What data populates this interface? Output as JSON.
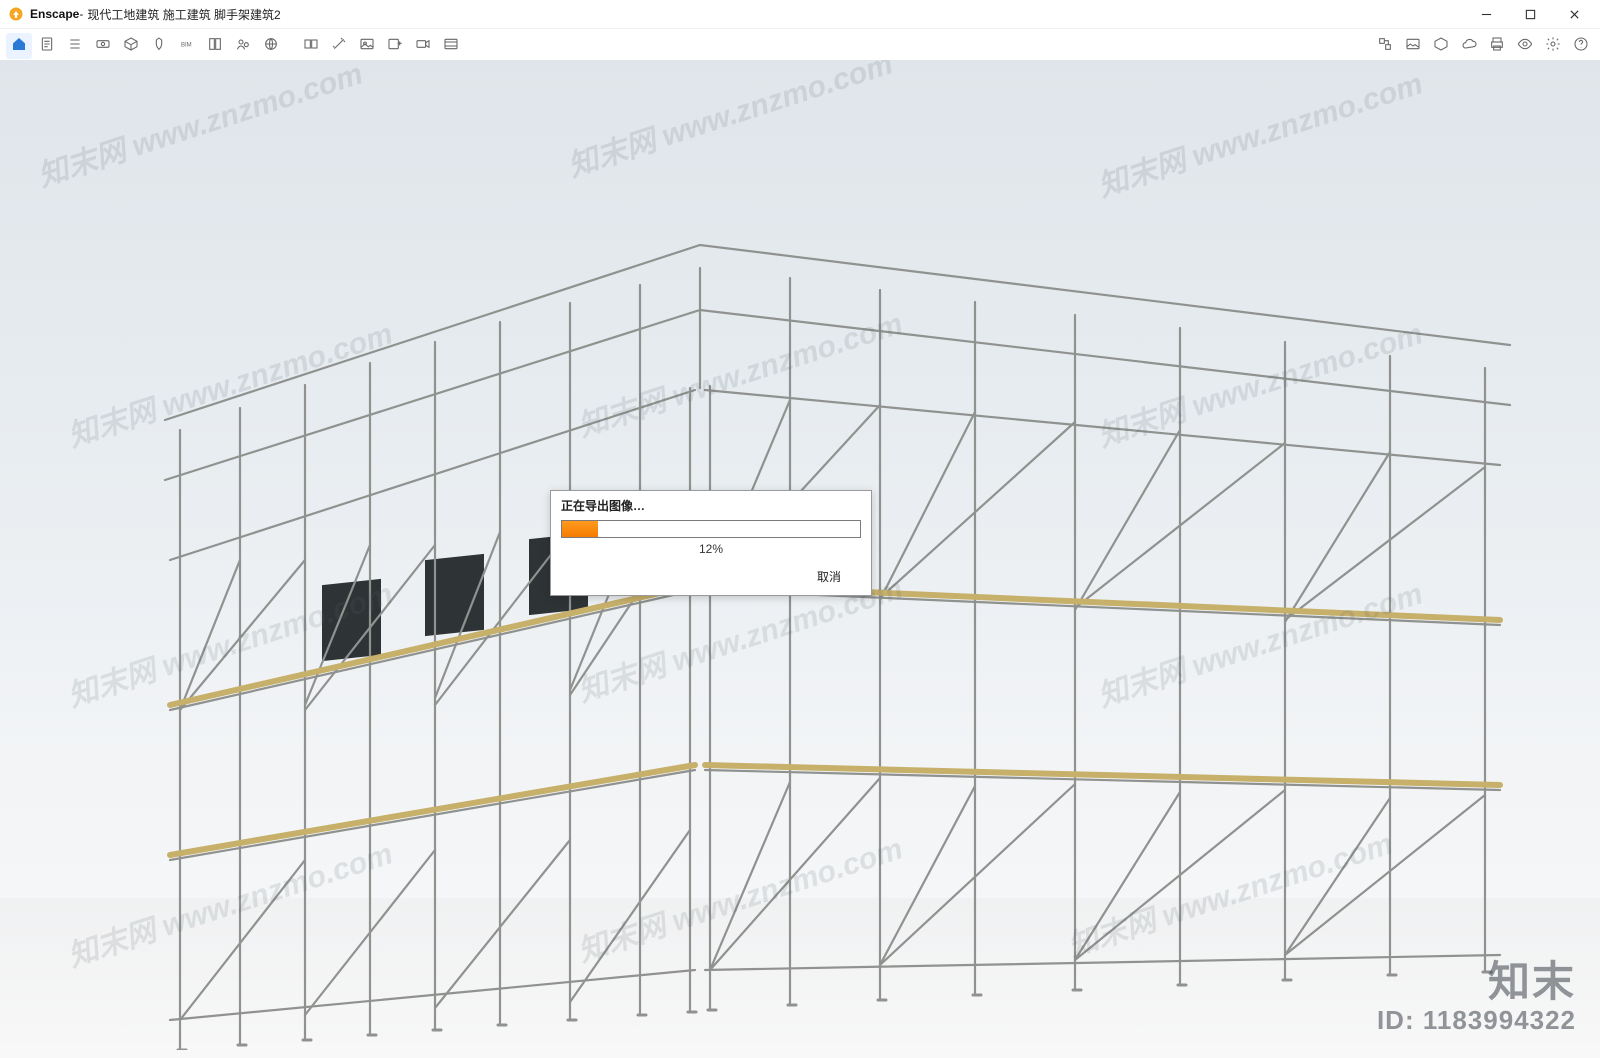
{
  "window": {
    "app_name": "Enscape",
    "separator": " - ",
    "document_title": "现代工地建筑 施工建筑 脚手架建筑2",
    "controls": {
      "minimize": "minimize",
      "maximize": "maximize",
      "close": "close"
    }
  },
  "toolbar_left": [
    {
      "name": "home-icon",
      "label": "Home"
    },
    {
      "name": "document-icon",
      "label": "Manage Views"
    },
    {
      "name": "list-icon",
      "label": "Manage Uploads"
    },
    {
      "name": "camera-path-icon",
      "label": "Video Path"
    },
    {
      "name": "cube-icon",
      "label": "Asset Library"
    },
    {
      "name": "badge-icon",
      "label": "Site Context"
    },
    {
      "name": "bim-icon",
      "label": "BIM"
    },
    {
      "name": "library-icon",
      "label": "Material Library"
    },
    {
      "name": "collab-icon",
      "label": "Collaboration"
    },
    {
      "name": "globe-icon",
      "label": "Web Standalone"
    }
  ],
  "toolbar_mid": [
    {
      "name": "sync-views-icon",
      "label": "Sync Views"
    },
    {
      "name": "wand-icon",
      "label": "Best Quality"
    },
    {
      "name": "image-icon",
      "label": "Screenshot"
    },
    {
      "name": "image-plus-icon",
      "label": "Batch Render"
    },
    {
      "name": "video-icon",
      "label": "Video"
    },
    {
      "name": "mono-icon",
      "label": "Mono Panorama"
    }
  ],
  "toolbar_right": [
    {
      "name": "link-model-icon",
      "label": "Link Model"
    },
    {
      "name": "picture-icon",
      "label": "Image"
    },
    {
      "name": "box-icon",
      "label": "3D"
    },
    {
      "name": "cloud-icon",
      "label": "Upload"
    },
    {
      "name": "print-icon",
      "label": "Print"
    },
    {
      "name": "eye-icon",
      "label": "Visual Settings"
    },
    {
      "name": "gear-icon",
      "label": "General Settings"
    },
    {
      "name": "help-icon",
      "label": "Help"
    }
  ],
  "dialog": {
    "title": "正在导出图像…",
    "progress_percent": 12,
    "progress_text": "12%",
    "progress_width": "12%",
    "cancel_label": "取消"
  },
  "watermark": {
    "text": "知末网 www.znzmo.com",
    "brand_name": "知末",
    "brand_id_label": "ID: 1183994322"
  }
}
